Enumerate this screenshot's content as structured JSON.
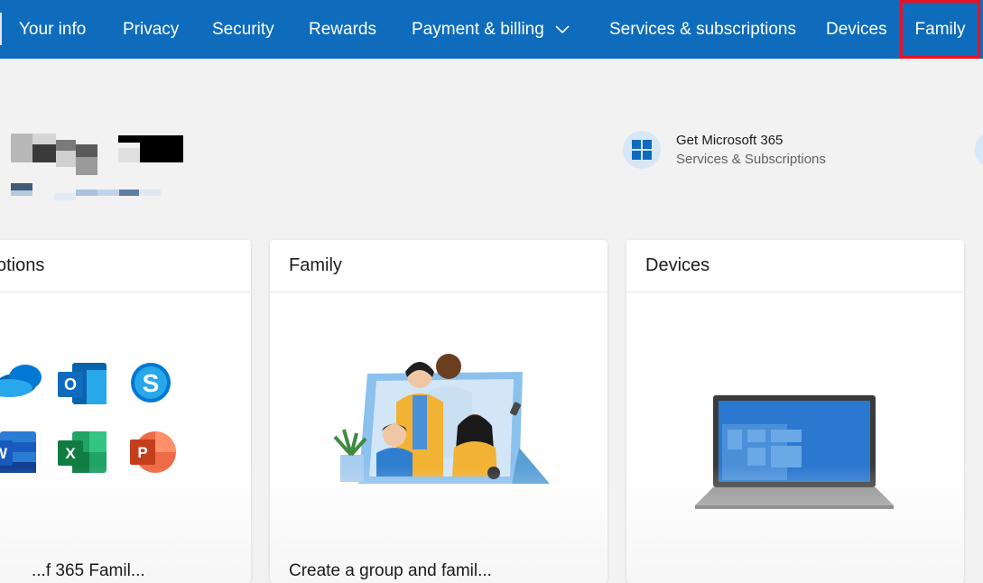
{
  "nav": {
    "items": [
      {
        "label": "Your info"
      },
      {
        "label": "Privacy"
      },
      {
        "label": "Security"
      },
      {
        "label": "Rewards"
      },
      {
        "label": "Payment & billing",
        "has_dropdown": true
      },
      {
        "label": "Services & subscriptions"
      },
      {
        "label": "Devices"
      },
      {
        "label": "Family",
        "active": true
      }
    ],
    "accent_color": "#0f6cbd",
    "highlight_color": "#e81123"
  },
  "promo": {
    "title": "Get Microsoft 365",
    "subtitle": "Services & Subscriptions",
    "icon": "windows-grid-icon"
  },
  "cards": [
    {
      "title": "otions",
      "footer": "...f 365 Famil..."
    },
    {
      "title": "Family",
      "footer": "Create a group and famil..."
    },
    {
      "title": "Devices",
      "footer": ""
    }
  ]
}
